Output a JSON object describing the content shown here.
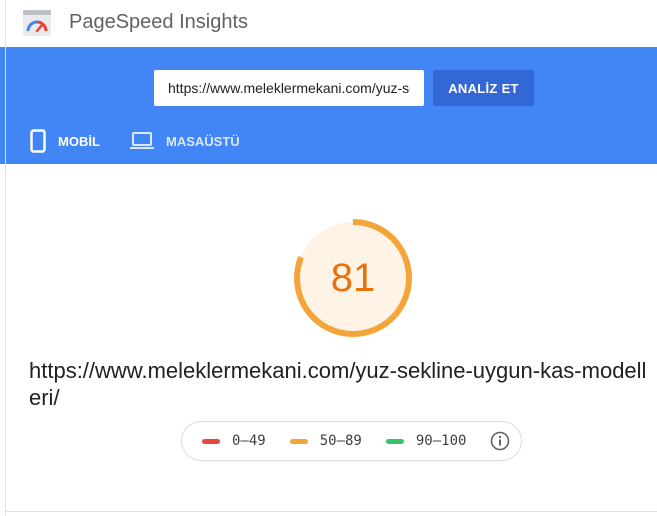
{
  "app": {
    "title": "PageSpeed Insights"
  },
  "search": {
    "url_value": "https://www.meleklermekani.com/yuz-sekline-uygun-kas-modelleri/",
    "analyze_label": "ANALİZ ET"
  },
  "tabs": [
    {
      "label": "MOBİL",
      "icon": "smartphone-icon",
      "active": true
    },
    {
      "label": "MASAÜSTÜ",
      "icon": "laptop-icon",
      "active": false
    }
  ],
  "result": {
    "score": 81,
    "tested_url": "https://www.meleklermekani.com/yuz-sekline-uygun-kas-modelleri/"
  },
  "legend": [
    {
      "label": "0–49",
      "color": "#e8453c"
    },
    {
      "label": "50–89",
      "color": "#f4a53a"
    },
    {
      "label": "90–100",
      "color": "#34c56a"
    }
  ],
  "colors": {
    "banner": "#4285f4",
    "button": "#3367d6",
    "score": "#e8710a",
    "gauge_bg": "#fff3e6"
  }
}
